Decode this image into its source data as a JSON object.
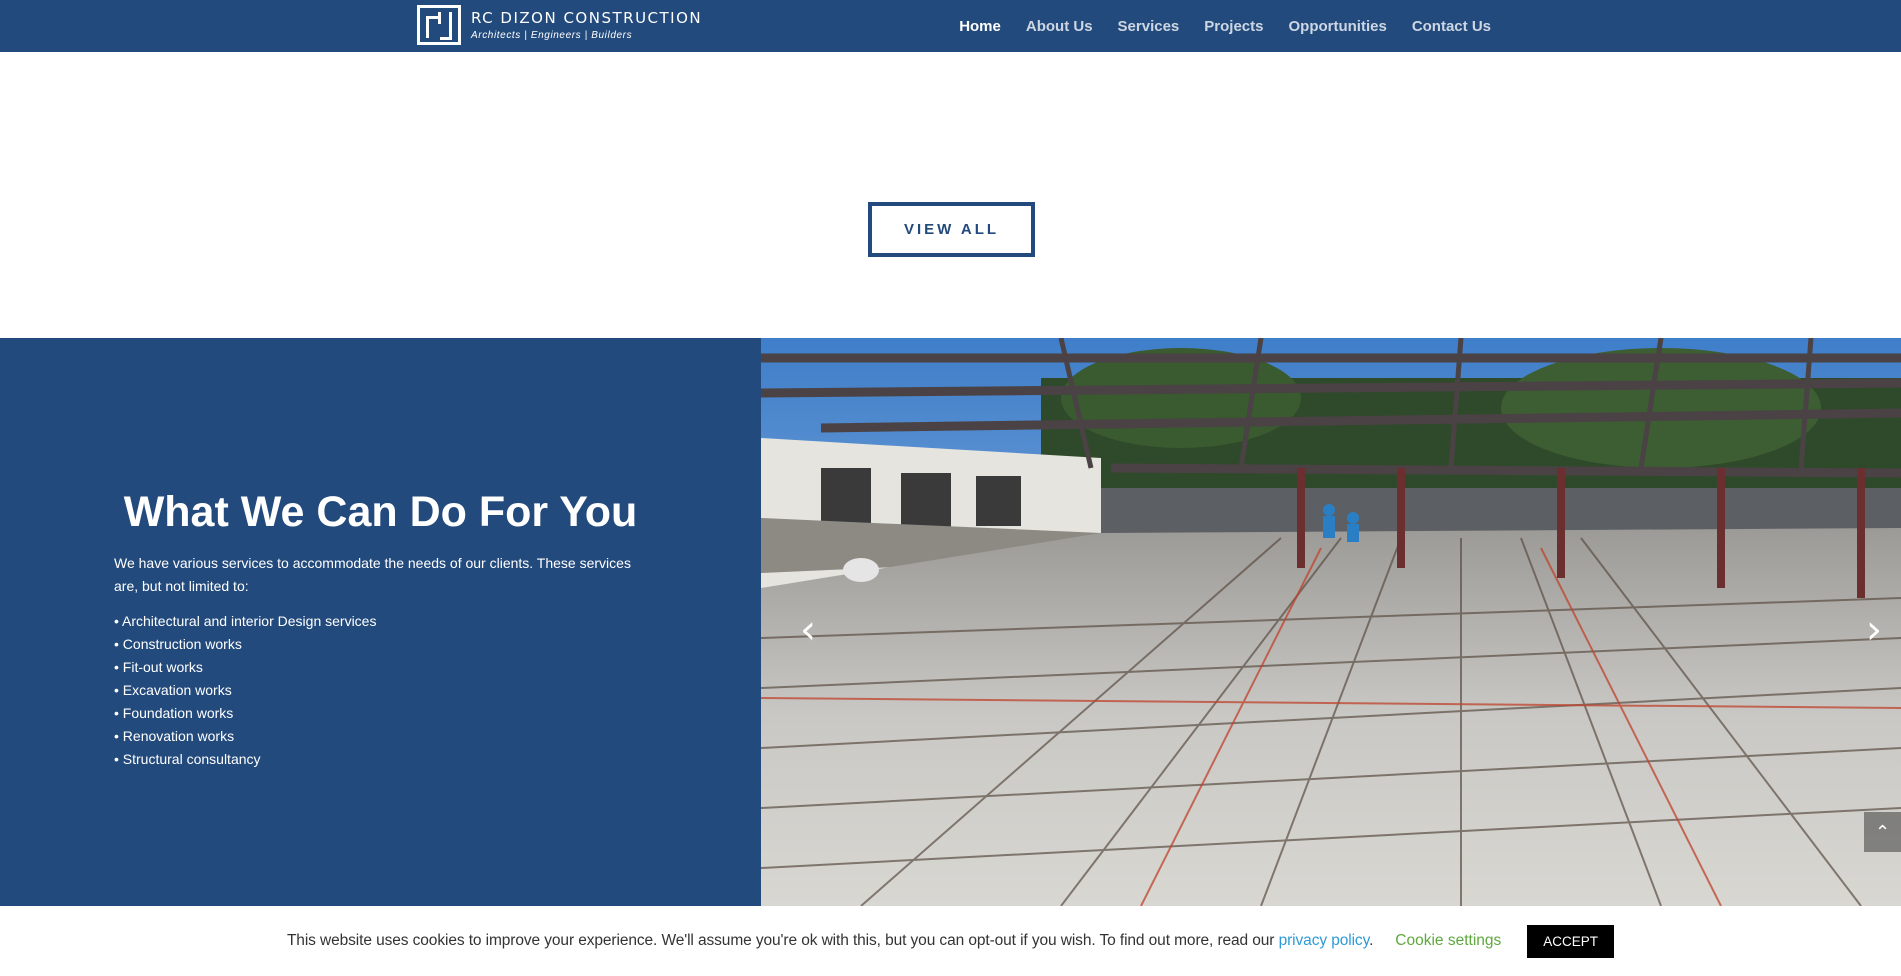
{
  "brand": {
    "name": "RC DIZON CONSTRUCTION",
    "tagline": "Architects   |   Engineers   |   Builders"
  },
  "nav": {
    "items": [
      {
        "label": "Home",
        "active": true
      },
      {
        "label": "About Us"
      },
      {
        "label": "Services"
      },
      {
        "label": "Projects"
      },
      {
        "label": "Opportunities"
      },
      {
        "label": "Contact Us"
      }
    ]
  },
  "projects": {
    "view_all_label": "VIEW ALL"
  },
  "services": {
    "title": "What We Can Do For You",
    "intro": "We have various services to accommodate the needs of our clients. These services are, but not limited to:",
    "items": [
      "• Architectural and interior Design services",
      "• Construction works",
      "• Fit-out works",
      "• Excavation works",
      "• Foundation works",
      "• Renovation works",
      "• Structural consultancy"
    ]
  },
  "slider": {
    "prev_arrow": "‹",
    "next_arrow": "›",
    "scroll_top_glyph": "⌃"
  },
  "cookie": {
    "message": "This website uses cookies to improve your experience. We'll assume you're ok with this, but you can opt-out if you wish. To find out more, read our ",
    "policy_link": "privacy policy",
    "period": ".",
    "settings_label": "Cookie settings",
    "accept_label": "ACCEPT"
  },
  "colors": {
    "brand_blue": "#234a7c",
    "link_blue": "#2f9ad8",
    "settings_green": "#5fa83f"
  }
}
